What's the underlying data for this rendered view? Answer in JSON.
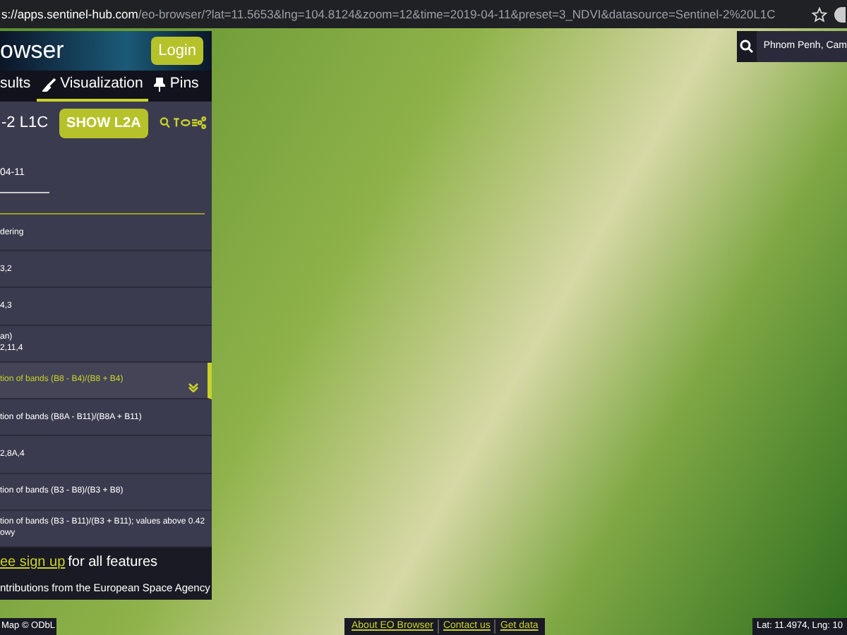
{
  "address_bar": {
    "url_host": "s://apps.sentinel-hub.com",
    "url_path": "/eo-browser/?lat=11.5653&lng=104.8124&zoom=12&time=2019-04-11&preset=3_NDVI&datasource=Sentinel-2%20L1C"
  },
  "panel": {
    "title": "owser",
    "login": "Login",
    "tabs": [
      {
        "label": "sults",
        "selected": false
      },
      {
        "label": "Visualization",
        "selected": true
      },
      {
        "label": "Pins",
        "selected": false
      }
    ],
    "source": "-2 L1C",
    "source_button": "SHOW L2A",
    "date": "04-11",
    "layers": [
      {
        "lines": [
          "dering"
        ],
        "selected": false
      },
      {
        "lines": [
          "3,2"
        ],
        "selected": false
      },
      {
        "lines": [
          "4,3"
        ],
        "selected": false
      },
      {
        "lines": [
          "an)",
          "2,11,4"
        ],
        "selected": false
      },
      {
        "lines": [
          "tion of bands (B8 - B4)/(B8 + B4)"
        ],
        "selected": true
      },
      {
        "lines": [
          "tion of bands (B8A - B11)/(B8A + B11)"
        ],
        "selected": false
      },
      {
        "lines": [
          "2,8A,4"
        ],
        "selected": false
      },
      {
        "lines": [
          "tion of bands (B3 - B8)/(B3 + B8)"
        ],
        "selected": false
      },
      {
        "lines": [
          "tion of bands (B3 - B11)/(B3 + B11); values above 0.42",
          "owy"
        ],
        "selected": false
      }
    ],
    "signup_link": "ee sign up",
    "signup_rest": "for all features",
    "credit": "ntributions from the European Space Agency"
  },
  "search": {
    "value": "Phnom Penh, Cam"
  },
  "attribution": "Map © ODbL",
  "footer_links": [
    "About EO Browser",
    "Contact us",
    "Get data"
  ],
  "coordinates": "Lat: 11.4974, Lng: 10"
}
